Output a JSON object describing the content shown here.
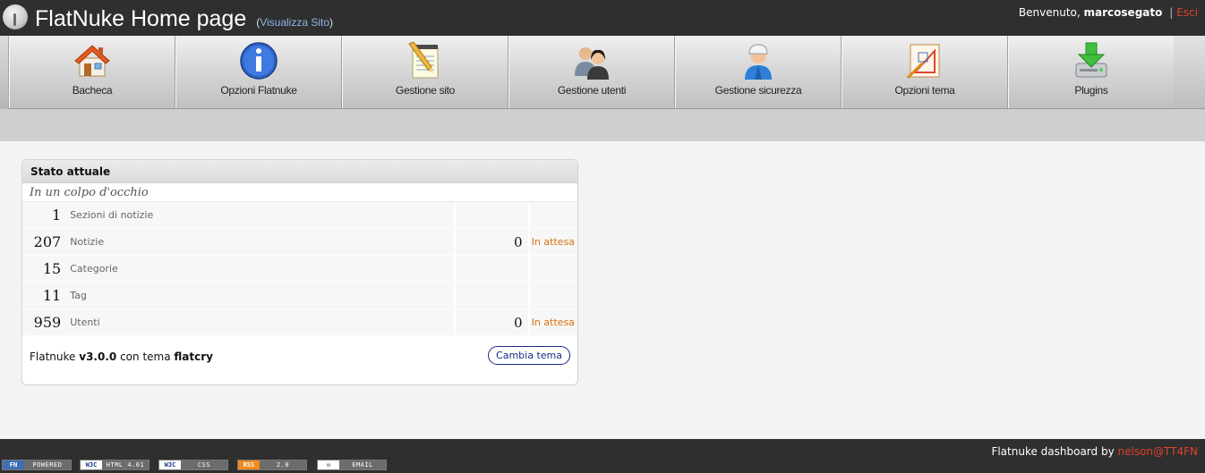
{
  "header": {
    "title": "FlatNuke Home page",
    "view_site_prefix": "(",
    "view_site_label": "Visualizza Sito",
    "view_site_suffix": ")",
    "welcome_text": "Benvenuto,",
    "username": "marcosegato",
    "separator": "|",
    "logout_label": "Esci"
  },
  "toolbar": {
    "items": [
      {
        "label": "Bacheca",
        "icon": "house-icon"
      },
      {
        "label": "Opzioni Flatnuke",
        "icon": "info-icon"
      },
      {
        "label": "Gestione sito",
        "icon": "notepad-pencil-icon"
      },
      {
        "label": "Gestione utenti",
        "icon": "users-icon"
      },
      {
        "label": "Gestione sicurezza",
        "icon": "security-user-icon"
      },
      {
        "label": "Opzioni tema",
        "icon": "theme-drawing-icon"
      },
      {
        "label": "Plugins",
        "icon": "download-drive-icon"
      }
    ]
  },
  "panel": {
    "title": "Stato attuale",
    "subtitle": "In un colpo d'occhio",
    "rows": [
      {
        "count": "1",
        "label": "Sezioni di notizie",
        "pending": "",
        "status": ""
      },
      {
        "count": "207",
        "label": "Notizie",
        "pending": "0",
        "status": "In attesa"
      },
      {
        "count": "15",
        "label": "Categorie",
        "pending": "",
        "status": ""
      },
      {
        "count": "11",
        "label": "Tag",
        "pending": "",
        "status": ""
      },
      {
        "count": "959",
        "label": "Utenti",
        "pending": "0",
        "status": "In attesa"
      }
    ],
    "version_prefix": "Flatnuke",
    "version": "v3.0.0",
    "theme_prefix": "con tema",
    "theme_name": "flatcry",
    "change_theme_label": "Cambia tema"
  },
  "footer": {
    "credit_text": "Flatnuke dashboard by",
    "credit_author": "nelson@TT4FN",
    "badges": [
      {
        "left": "FN",
        "right": "POWERED",
        "color": "#3e6fb3"
      },
      {
        "left": "W3C",
        "right": "HTML 4.01",
        "color": "#ffffff"
      },
      {
        "left": "W3C",
        "right": "CSS",
        "color": "#ffffff"
      },
      {
        "left": "RSS",
        "right": "2.0",
        "color": "#f08a1c"
      },
      {
        "left": "✉",
        "right": "EMAIL",
        "color": "#ffffff"
      }
    ]
  },
  "colors": {
    "header_bg": "#2f2f2f",
    "link_blue": "#8fb6e8",
    "logout_red": "#e0422b",
    "status_orange": "#d9700f",
    "button_blue": "#1b2c8a"
  }
}
